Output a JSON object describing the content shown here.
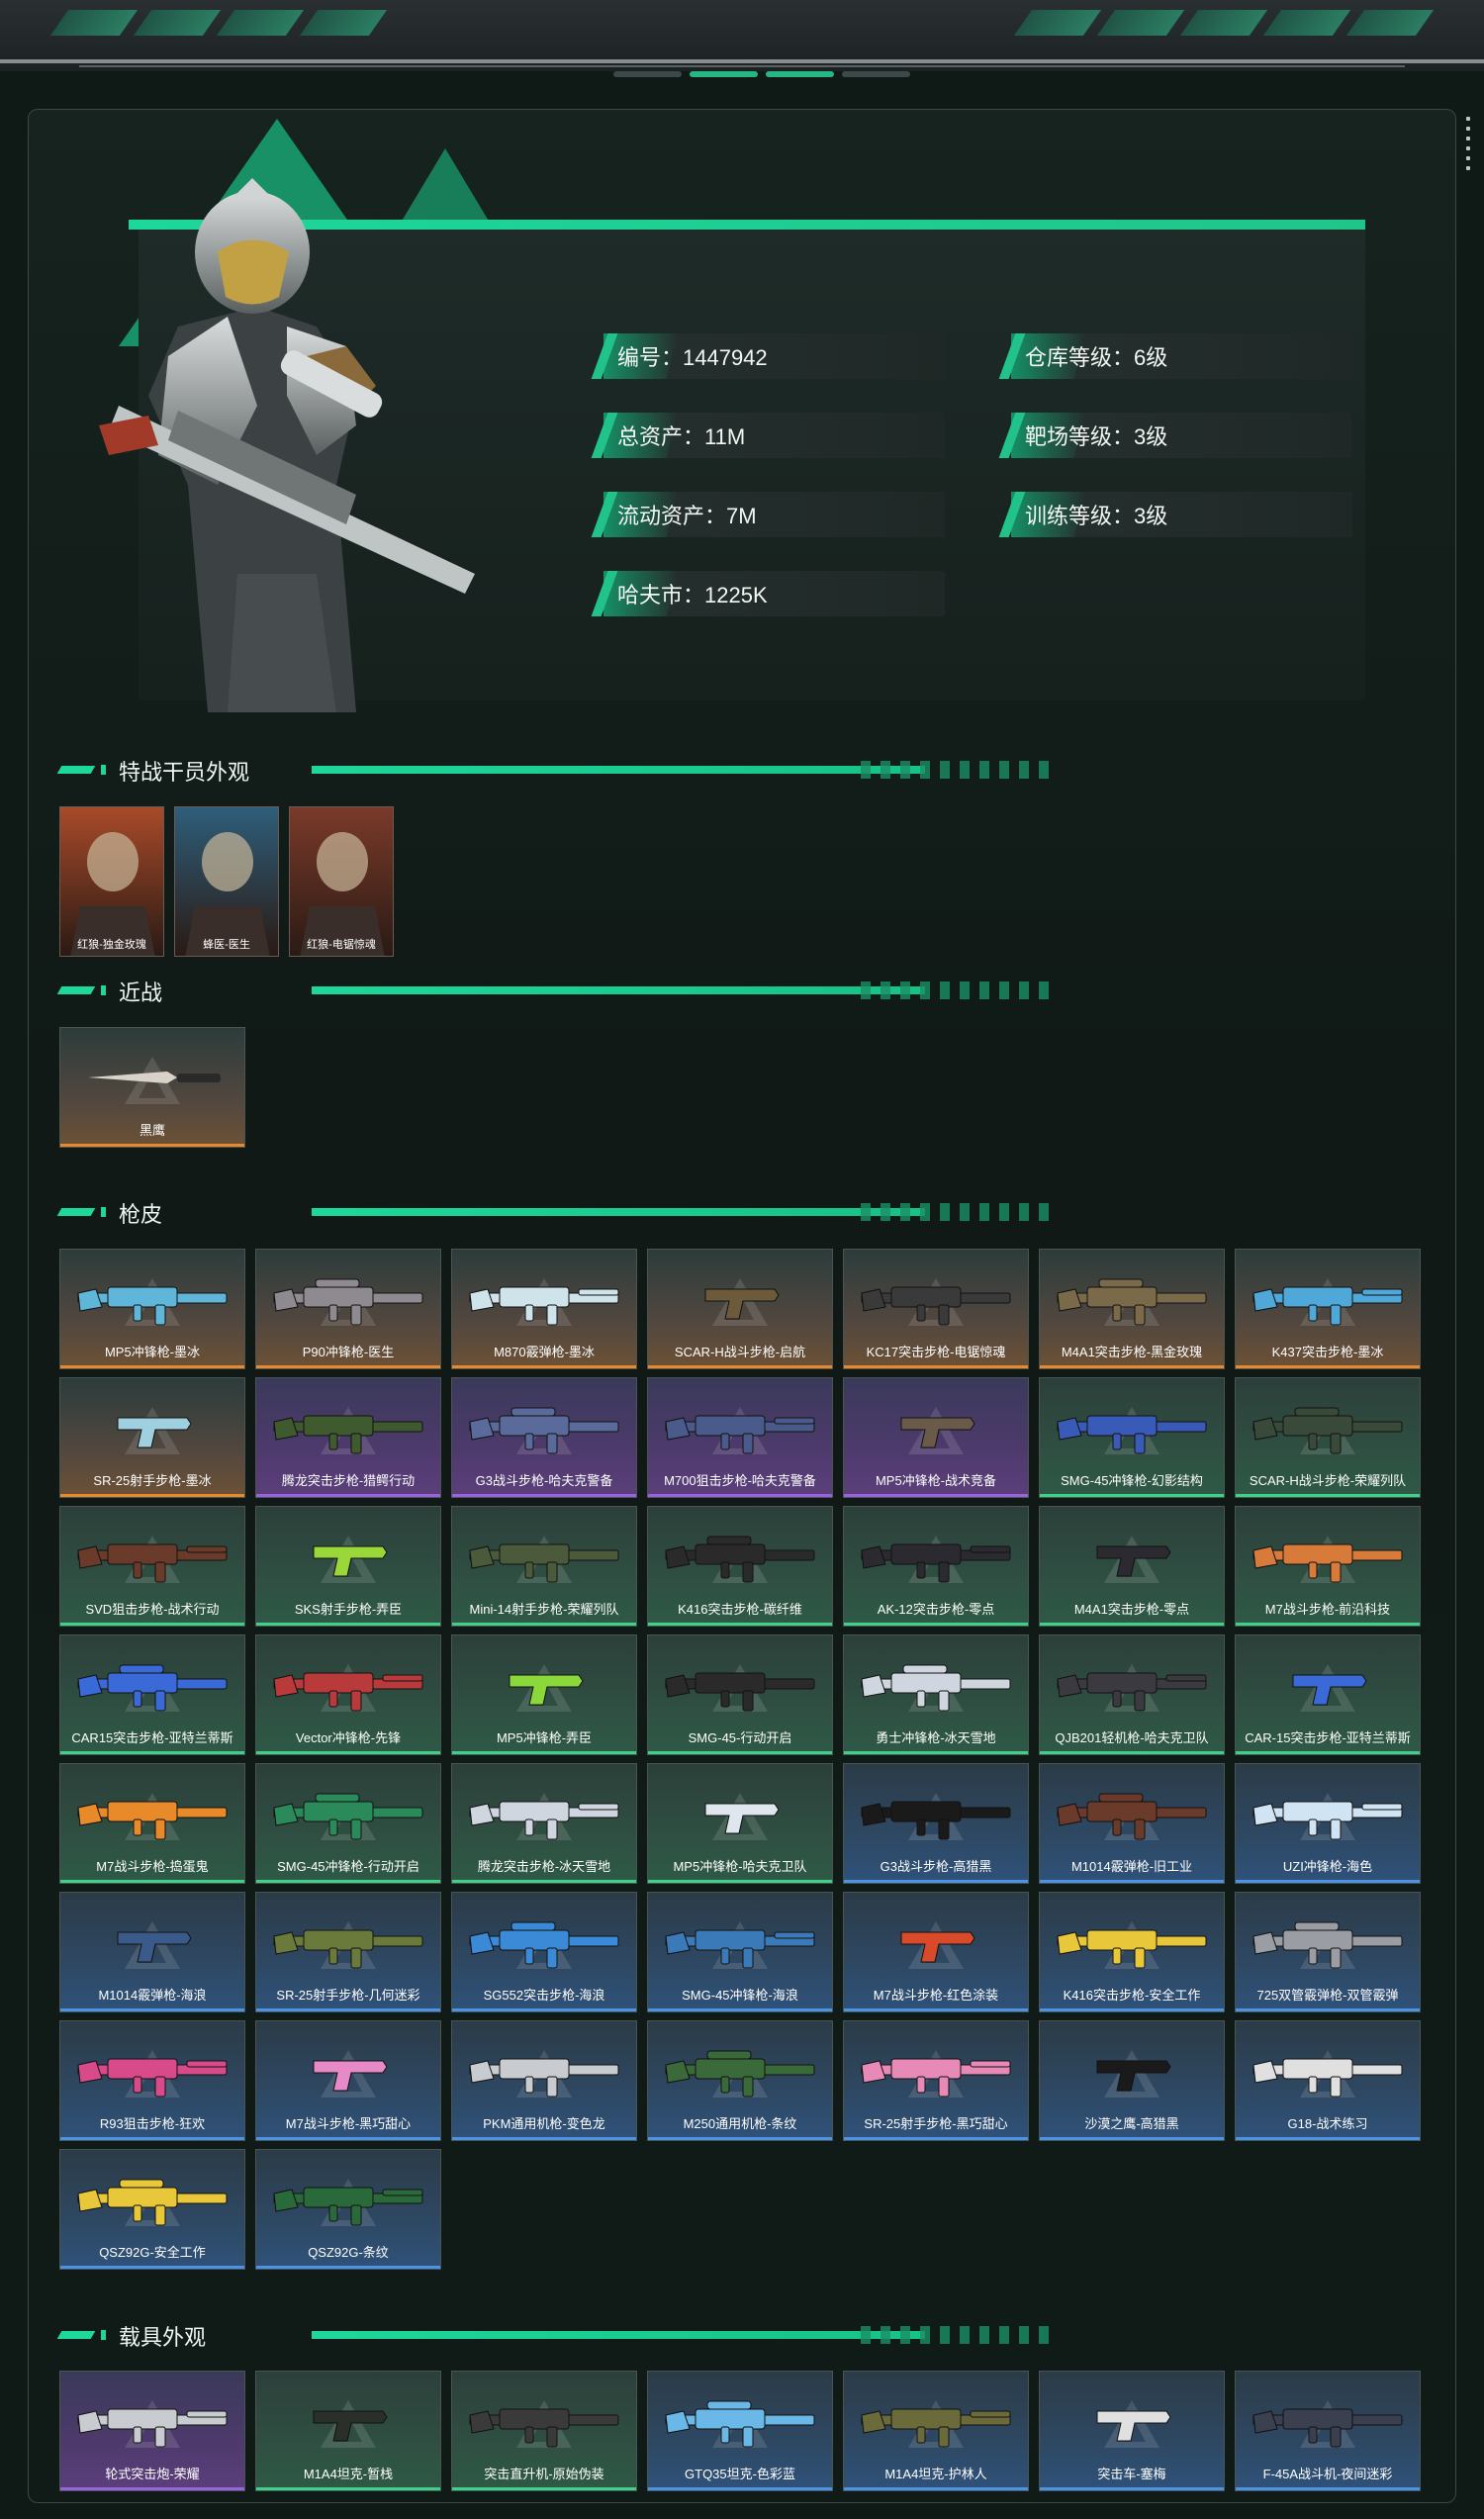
{
  "stats": {
    "id": "编号：1447942",
    "warehouse": "仓库等级：6级",
    "total_assets": "总资产：11M",
    "range": "靶场等级：3级",
    "liquid_assets": "流动资产：7M",
    "training": "训练等级：3级",
    "havcoin": "哈夫市：1225K"
  },
  "sections": {
    "agents": "特战干员外观",
    "melee": "近战",
    "guns": "枪皮",
    "vehicles": "载具外观"
  },
  "agents": [
    {
      "label": "红狼-独金玫瑰",
      "color": "#a84a2a"
    },
    {
      "label": "蜂医-医生",
      "color": "#2e5e7a"
    },
    {
      "label": "红狼-电锯惊魂",
      "color": "#7a3a2a"
    }
  ],
  "melee": [
    {
      "label": "黑鹰",
      "rarity": "orange"
    }
  ],
  "guns": [
    {
      "label": "MP5冲锋枪-墨冰",
      "rarity": "orange",
      "color": "#5fb6d9"
    },
    {
      "label": "P90冲锋枪-医生",
      "rarity": "orange",
      "color": "#8e8a90"
    },
    {
      "label": "M870霰弹枪-墨冰",
      "rarity": "orange",
      "color": "#cfe3ea"
    },
    {
      "label": "SCAR-H战斗步枪-启航",
      "rarity": "orange",
      "color": "#6d5a3a"
    },
    {
      "label": "KC17突击步枪-电锯惊魂",
      "rarity": "orange",
      "color": "#3a3a3a"
    },
    {
      "label": "M4A1突击步枪-黑金玫瑰",
      "rarity": "orange",
      "color": "#7a6a4a"
    },
    {
      "label": "K437突击步枪-墨冰",
      "rarity": "orange",
      "color": "#4fa8d8"
    },
    {
      "label": "SR-25射手步枪-墨冰",
      "rarity": "orange",
      "color": "#9fd0e0"
    },
    {
      "label": "腾龙突击步枪-猎鳄行动",
      "rarity": "purple",
      "color": "#3e5a2e"
    },
    {
      "label": "G3战斗步枪-哈夫克警备",
      "rarity": "purple",
      "color": "#5a6a9a"
    },
    {
      "label": "M700狙击步枪-哈夫克警备",
      "rarity": "purple",
      "color": "#4a5a8a"
    },
    {
      "label": "MP5冲锋枪-战术竞备",
      "rarity": "purple",
      "color": "#6a5a4a"
    },
    {
      "label": "SMG-45冲锋枪-幻影结构",
      "rarity": "green",
      "color": "#3a5ab8"
    },
    {
      "label": "SCAR-H战斗步枪-荣耀列队",
      "rarity": "green",
      "color": "#3a4a3a"
    },
    {
      "label": "SVD狙击步枪-战术行动",
      "rarity": "green",
      "color": "#6a3a2a"
    },
    {
      "label": "SKS射手步枪-弄臣",
      "rarity": "green",
      "color": "#9ad83a"
    },
    {
      "label": "Mini-14射手步枪-荣耀列队",
      "rarity": "green",
      "color": "#4a5a3a"
    },
    {
      "label": "K416突击步枪-碳纤维",
      "rarity": "green",
      "color": "#2a2a2a"
    },
    {
      "label": "AK-12突击步枪-零点",
      "rarity": "green",
      "color": "#2a2a30"
    },
    {
      "label": "M4A1突击步枪-零点",
      "rarity": "green",
      "color": "#2a2a30"
    },
    {
      "label": "M7战斗步枪-前沿科技",
      "rarity": "green",
      "color": "#d87a3a"
    },
    {
      "label": "CAR15突击步枪-亚特兰蒂斯",
      "rarity": "green",
      "color": "#3a6ad8"
    },
    {
      "label": "Vector冲锋枪-先锋",
      "rarity": "green",
      "color": "#b83a3a"
    },
    {
      "label": "MP5冲锋枪-弄臣",
      "rarity": "green",
      "color": "#8ad83a"
    },
    {
      "label": "SMG-45-行动开启",
      "rarity": "green",
      "color": "#2a2a2a"
    },
    {
      "label": "勇士冲锋枪-冰天雪地",
      "rarity": "green",
      "color": "#cfd6e0"
    },
    {
      "label": "QJB201轻机枪-哈夫克卫队",
      "rarity": "green",
      "color": "#3a3a40"
    },
    {
      "label": "CAR-15突击步枪-亚特兰蒂斯",
      "rarity": "green",
      "color": "#3a6ad8"
    },
    {
      "label": "M7战斗步枪-捣蛋鬼",
      "rarity": "green",
      "color": "#e88a2a"
    },
    {
      "label": "SMG-45冲锋枪-行动开启",
      "rarity": "green",
      "color": "#2a8a5a"
    },
    {
      "label": "腾龙突击步枪-冰天雪地",
      "rarity": "green",
      "color": "#cfd6e0"
    },
    {
      "label": "MP5冲锋枪-哈夫克卫队",
      "rarity": "green",
      "color": "#e0e6ee"
    },
    {
      "label": "G3战斗步枪-高猎黑",
      "rarity": "blue",
      "color": "#1a1a1a"
    },
    {
      "label": "M1014霰弹枪-旧工业",
      "rarity": "blue",
      "color": "#6a3a2a"
    },
    {
      "label": "UZI冲锋枪-海色",
      "rarity": "blue",
      "color": "#d0e4f4"
    },
    {
      "label": "M1014霰弹枪-海浪",
      "rarity": "blue",
      "color": "#3a5a8a"
    },
    {
      "label": "SR-25射手步枪-几何迷彩",
      "rarity": "blue",
      "color": "#6a7a3a"
    },
    {
      "label": "SG552突击步枪-海浪",
      "rarity": "blue",
      "color": "#3a8ad8"
    },
    {
      "label": "SMG-45冲锋枪-海浪",
      "rarity": "blue",
      "color": "#3a7ab8"
    },
    {
      "label": "M7战斗步枪-红色涂装",
      "rarity": "blue",
      "color": "#d84a2a"
    },
    {
      "label": "K416突击步枪-安全工作",
      "rarity": "blue",
      "color": "#e8c83a"
    },
    {
      "label": "725双管霰弹枪-双管霰弹",
      "rarity": "blue",
      "color": "#9a9ea4"
    },
    {
      "label": "R93狙击步枪-狂欢",
      "rarity": "blue",
      "color": "#d84a8a"
    },
    {
      "label": "M7战斗步枪-黑巧甜心",
      "rarity": "blue",
      "color": "#e88ac8"
    },
    {
      "label": "PKM通用机枪-变色龙",
      "rarity": "blue",
      "color": "#c8ccd0"
    },
    {
      "label": "M250通用机枪-条纹",
      "rarity": "blue",
      "color": "#3a6a3a"
    },
    {
      "label": "SR-25射手步枪-黑巧甜心",
      "rarity": "blue",
      "color": "#e88ab8"
    },
    {
      "label": "沙漠之鹰-高猎黑",
      "rarity": "blue",
      "color": "#1a1a1a"
    },
    {
      "label": "G18-战术练习",
      "rarity": "blue",
      "color": "#e0e0e0"
    },
    {
      "label": "QSZ92G-安全工作",
      "rarity": "blue",
      "color": "#e8c83a"
    },
    {
      "label": "QSZ92G-条纹",
      "rarity": "blue",
      "color": "#2a6a3a"
    }
  ],
  "vehicles": [
    {
      "label": "轮式突击炮-荣耀",
      "rarity": "purple",
      "color": "#c8ccd0"
    },
    {
      "label": "M1A4坦克-暂栈",
      "rarity": "green",
      "color": "#2a2f2a"
    },
    {
      "label": "突击直升机-原始伪装",
      "rarity": "green",
      "color": "#3a3a3a"
    },
    {
      "label": "GTQ35坦克-色彩蓝",
      "rarity": "blue",
      "color": "#6ab8e8"
    },
    {
      "label": "M1A4坦克-护林人",
      "rarity": "blue",
      "color": "#6a6a3a"
    },
    {
      "label": "突击车-塞梅",
      "rarity": "blue",
      "color": "#e0e0e0"
    },
    {
      "label": "F-45A战斗机-夜间迷彩",
      "rarity": "blue",
      "color": "#3a4050"
    }
  ]
}
